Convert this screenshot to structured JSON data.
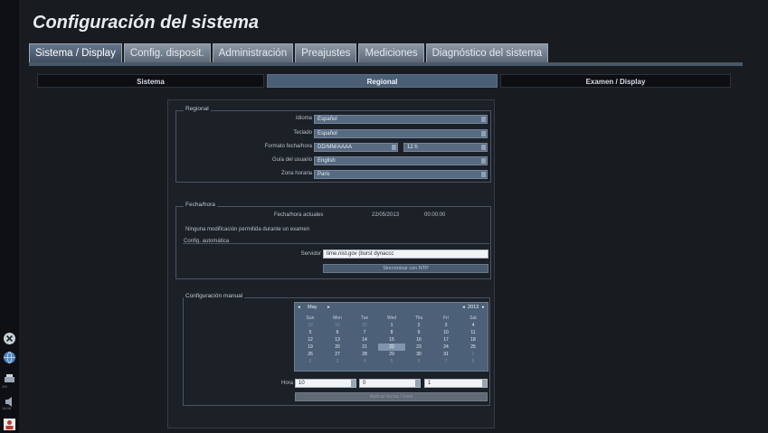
{
  "title": "Configuración del sistema",
  "tabs": [
    "Sistema / Display",
    "Config. disposit.",
    "Administración",
    "Preajustes",
    "Mediciones",
    "Diagnóstico del sistema"
  ],
  "subtabs": [
    "Sistema",
    "Regional",
    "Examen / Display"
  ],
  "dock": {
    "label1": "1%",
    "label2": "14:09"
  },
  "regional": {
    "group_title": "Regional",
    "idioma_label": "Idioma",
    "idioma_value": "Español",
    "teclado_label": "Teclado",
    "teclado_value": "Español",
    "formato_label": "Formato fecha/hora",
    "formato_value": "DD/MM/AAAA",
    "hora_formato_value": "12 h",
    "guia_label": "Guía del usuario",
    "guia_value": "English",
    "zona_label": "Zona horaria",
    "zona_value": "Paris"
  },
  "fechahora": {
    "group_title": "Fecha/hora",
    "actual_label": "Fecha/hora actuales",
    "actual_date": "22/05/2013",
    "actual_time": "00:00:00",
    "warning": "Ninguna modificación permitida durante un examen",
    "auto_title": "Config. automática",
    "servidor_label": "Servidor",
    "servidor_value": "time.nist.gov (burst dynaccc",
    "sync_button": "Sincronizar con NTP"
  },
  "manual": {
    "group_title": "Configuración manual",
    "month": "May",
    "year": "2013",
    "weekdays": [
      "Sun",
      "Mon",
      "Tue",
      "Wed",
      "Thu",
      "Fri",
      "Sat"
    ],
    "days": [
      "28",
      "29",
      "30",
      "1",
      "2",
      "3",
      "4",
      "5",
      "6",
      "7",
      "8",
      "9",
      "10",
      "11",
      "12",
      "13",
      "14",
      "15",
      "16",
      "17",
      "18",
      "19",
      "20",
      "21",
      "22",
      "23",
      "24",
      "25",
      "26",
      "27",
      "28",
      "29",
      "30",
      "31",
      "1",
      "2",
      "3",
      "4",
      "5",
      "6",
      "7",
      "8"
    ],
    "hora_label": "Hora",
    "hour": "10",
    "minute": "0",
    "period": "1",
    "apply_button": "Aplicar fecha / hora"
  }
}
